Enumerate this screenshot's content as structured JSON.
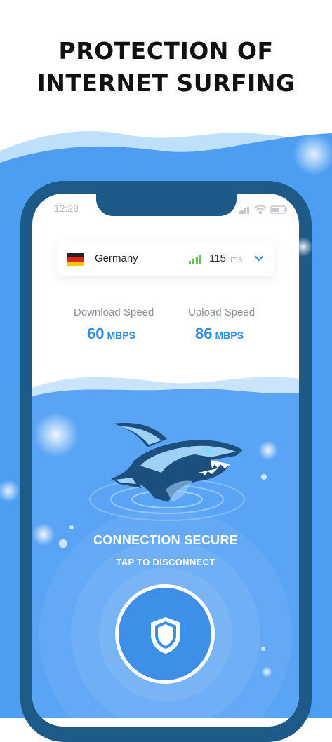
{
  "headline": {
    "line1": "PROTECTION OF",
    "line2": "INTERNET SURFING"
  },
  "status_bar": {
    "time": "12:28"
  },
  "server": {
    "country": "Germany",
    "ping_value": "115",
    "ping_unit": "ms"
  },
  "speeds": {
    "download_label": "Download Speed",
    "download_value": "60",
    "download_unit": "MBPS",
    "upload_label": "Upload Speed",
    "upload_value": "86",
    "upload_unit": "MBPS"
  },
  "connection": {
    "status": "CONNECTION SECURE",
    "action": "TAP TO DISCONNECT"
  },
  "icons": [
    "germany-flag-icon",
    "signal-bars-icon",
    "chevron-down-icon",
    "shark-logo-icon",
    "shield-icon",
    "wifi-icon",
    "battery-icon"
  ],
  "colors": {
    "accent": "#2f8de4",
    "water": "#5aa4f5",
    "phone_frame": "#1d5a87",
    "signal": "#6cc04a"
  }
}
